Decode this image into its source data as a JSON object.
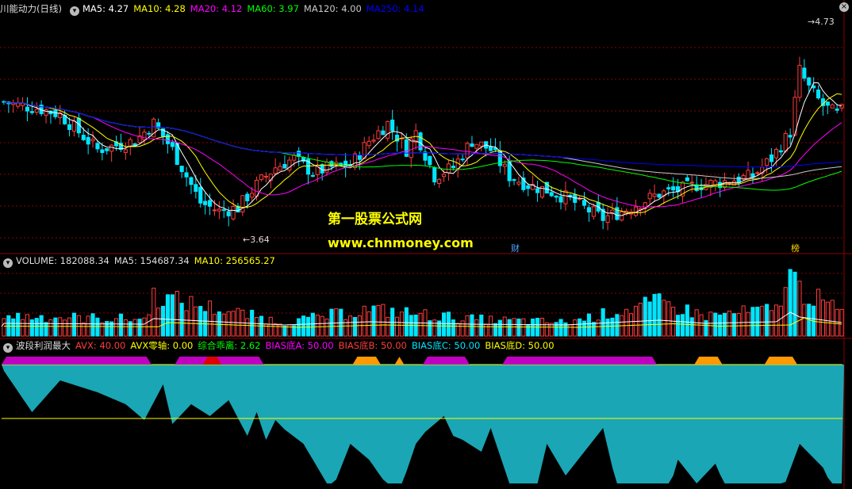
{
  "colors": {
    "up": "#ff3c3c",
    "down": "#00e5ff",
    "ma5": "#ffffff",
    "ma10": "#ffff00",
    "ma20": "#ff00ff",
    "ma60": "#00ff00",
    "ma120": "#c8c8c8",
    "ma250": "#0000ff",
    "teal": "#1aa6b4",
    "magenta": "#c000c0",
    "orange": "#ff9900",
    "red": "#e00000",
    "yellowline": "#ffff00",
    "grid": "#8b0000"
  },
  "main": {
    "title": "川能动力(日线)",
    "ma": [
      {
        "label": "MA5: 4.27",
        "color": "#ffffff"
      },
      {
        "label": "MA10: 4.28",
        "color": "#ffff00"
      },
      {
        "label": "MA20: 4.12",
        "color": "#ff00ff"
      },
      {
        "label": "MA60: 3.97",
        "color": "#00ff00"
      },
      {
        "label": "MA120: 4.00",
        "color": "#c8c8c8"
      },
      {
        "label": "MA250: 4.14",
        "color": "#0000ff"
      }
    ],
    "high_label": "4.73",
    "low_label": "3.64",
    "tag_cai": "财",
    "tag_bang": "榜",
    "watermark_cn": "第一股票公式网",
    "watermark_url": "www.chnmoney.com"
  },
  "vol": {
    "labels": [
      {
        "label": "VOLUME: 182088.34",
        "color": "#dddddd"
      },
      {
        "label": "MA5: 154687.34",
        "color": "#dddddd"
      },
      {
        "label": "MA10: 256565.27",
        "color": "#ffff00"
      }
    ]
  },
  "ind": {
    "title": "波段利润最大",
    "labels": [
      {
        "label": "AVX: 40.00",
        "color": "#ff3c3c"
      },
      {
        "label": "AVX零轴: 0.00",
        "color": "#ffff00"
      },
      {
        "label": "综合乖离: 2.62",
        "color": "#00ff00"
      },
      {
        "label": "BIAS底A: 50.00",
        "color": "#ff00ff"
      },
      {
        "label": "BIAS底B: 50.00",
        "color": "#ff3c3c"
      },
      {
        "label": "BIAS底C: 50.00",
        "color": "#00e5ff"
      },
      {
        "label": "BIAS底D: 50.00",
        "color": "#ffff00"
      }
    ]
  },
  "chart_data": {
    "type": "candlestick",
    "ylim": [
      3.55,
      4.8
    ],
    "high": 4.73,
    "low": 3.64,
    "n_bars": 180,
    "anchors": [
      [
        0,
        4.32
      ],
      [
        8,
        4.28
      ],
      [
        12,
        4.25
      ],
      [
        20,
        4.05
      ],
      [
        28,
        4.1
      ],
      [
        32,
        4.2
      ],
      [
        36,
        4.05
      ],
      [
        40,
        3.85
      ],
      [
        42,
        3.75
      ],
      [
        46,
        3.7
      ],
      [
        50,
        3.72
      ],
      [
        54,
        3.85
      ],
      [
        58,
        3.95
      ],
      [
        62,
        4.0
      ],
      [
        66,
        3.92
      ],
      [
        70,
        3.95
      ],
      [
        74,
        3.96
      ],
      [
        78,
        4.1
      ],
      [
        82,
        4.2
      ],
      [
        86,
        4.05
      ],
      [
        88,
        4.15
      ],
      [
        92,
        3.9
      ],
      [
        96,
        3.95
      ],
      [
        100,
        4.1
      ],
      [
        104,
        4.05
      ],
      [
        108,
        3.9
      ],
      [
        112,
        3.85
      ],
      [
        116,
        3.82
      ],
      [
        120,
        3.78
      ],
      [
        124,
        3.72
      ],
      [
        128,
        3.66
      ],
      [
        132,
        3.7
      ],
      [
        136,
        3.75
      ],
      [
        140,
        3.8
      ],
      [
        144,
        3.82
      ],
      [
        148,
        3.85
      ],
      [
        152,
        3.86
      ],
      [
        156,
        3.88
      ],
      [
        160,
        3.9
      ],
      [
        164,
        4.0
      ],
      [
        168,
        4.15
      ],
      [
        170,
        4.5
      ],
      [
        172,
        4.4
      ],
      [
        175,
        4.3
      ],
      [
        178,
        4.25
      ],
      [
        179,
        4.27
      ]
    ],
    "volume_anchors": [
      [
        0,
        0.3
      ],
      [
        30,
        0.25
      ],
      [
        32,
        0.6
      ],
      [
        60,
        0.2
      ],
      [
        78,
        0.4
      ],
      [
        100,
        0.25
      ],
      [
        120,
        0.2
      ],
      [
        140,
        0.5
      ],
      [
        150,
        0.3
      ],
      [
        165,
        0.4
      ],
      [
        168,
        1.0
      ],
      [
        170,
        0.7
      ],
      [
        179,
        0.35
      ]
    ],
    "indicator_fill_anchors": [
      [
        0,
        8
      ],
      [
        6,
        60
      ],
      [
        12,
        20
      ],
      [
        20,
        35
      ],
      [
        26,
        50
      ],
      [
        30,
        70
      ],
      [
        34,
        25
      ],
      [
        36,
        75
      ],
      [
        40,
        50
      ],
      [
        44,
        65
      ],
      [
        48,
        45
      ],
      [
        52,
        90
      ],
      [
        54,
        60
      ],
      [
        56,
        95
      ],
      [
        58,
        70
      ],
      [
        60,
        82
      ],
      [
        64,
        100
      ],
      [
        70,
        160
      ],
      [
        74,
        100
      ],
      [
        78,
        120
      ],
      [
        84,
        170
      ],
      [
        88,
        100
      ],
      [
        90,
        85
      ],
      [
        94,
        65
      ],
      [
        96,
        90
      ],
      [
        98,
        95
      ],
      [
        102,
        110
      ],
      [
        104,
        80
      ],
      [
        108,
        150
      ],
      [
        112,
        200
      ],
      [
        116,
        100
      ],
      [
        120,
        140
      ],
      [
        124,
        110
      ],
      [
        128,
        80
      ],
      [
        132,
        180
      ],
      [
        134,
        200
      ],
      [
        136,
        170
      ],
      [
        140,
        200
      ],
      [
        144,
        120
      ],
      [
        148,
        150
      ],
      [
        152,
        125
      ],
      [
        156,
        180
      ],
      [
        160,
        150
      ],
      [
        165,
        180
      ],
      [
        170,
        100
      ],
      [
        175,
        130
      ],
      [
        179,
        180
      ]
    ],
    "indicator_bands": [
      {
        "from": 0,
        "to": 32,
        "color": "#c000c0"
      },
      {
        "from": 37,
        "to": 56,
        "color": "#c000c0"
      },
      {
        "from": 43,
        "to": 47,
        "color": "#e00000"
      },
      {
        "from": 75,
        "to": 81,
        "color": "#ff9900"
      },
      {
        "from": 84,
        "to": 86,
        "color": "#ff9900"
      },
      {
        "from": 90,
        "to": 100,
        "color": "#c000c0"
      },
      {
        "from": 107,
        "to": 140,
        "color": "#c000c0"
      },
      {
        "from": 148,
        "to": 154,
        "color": "#ff9900"
      },
      {
        "from": 163,
        "to": 170,
        "color": "#ff9900"
      }
    ]
  }
}
